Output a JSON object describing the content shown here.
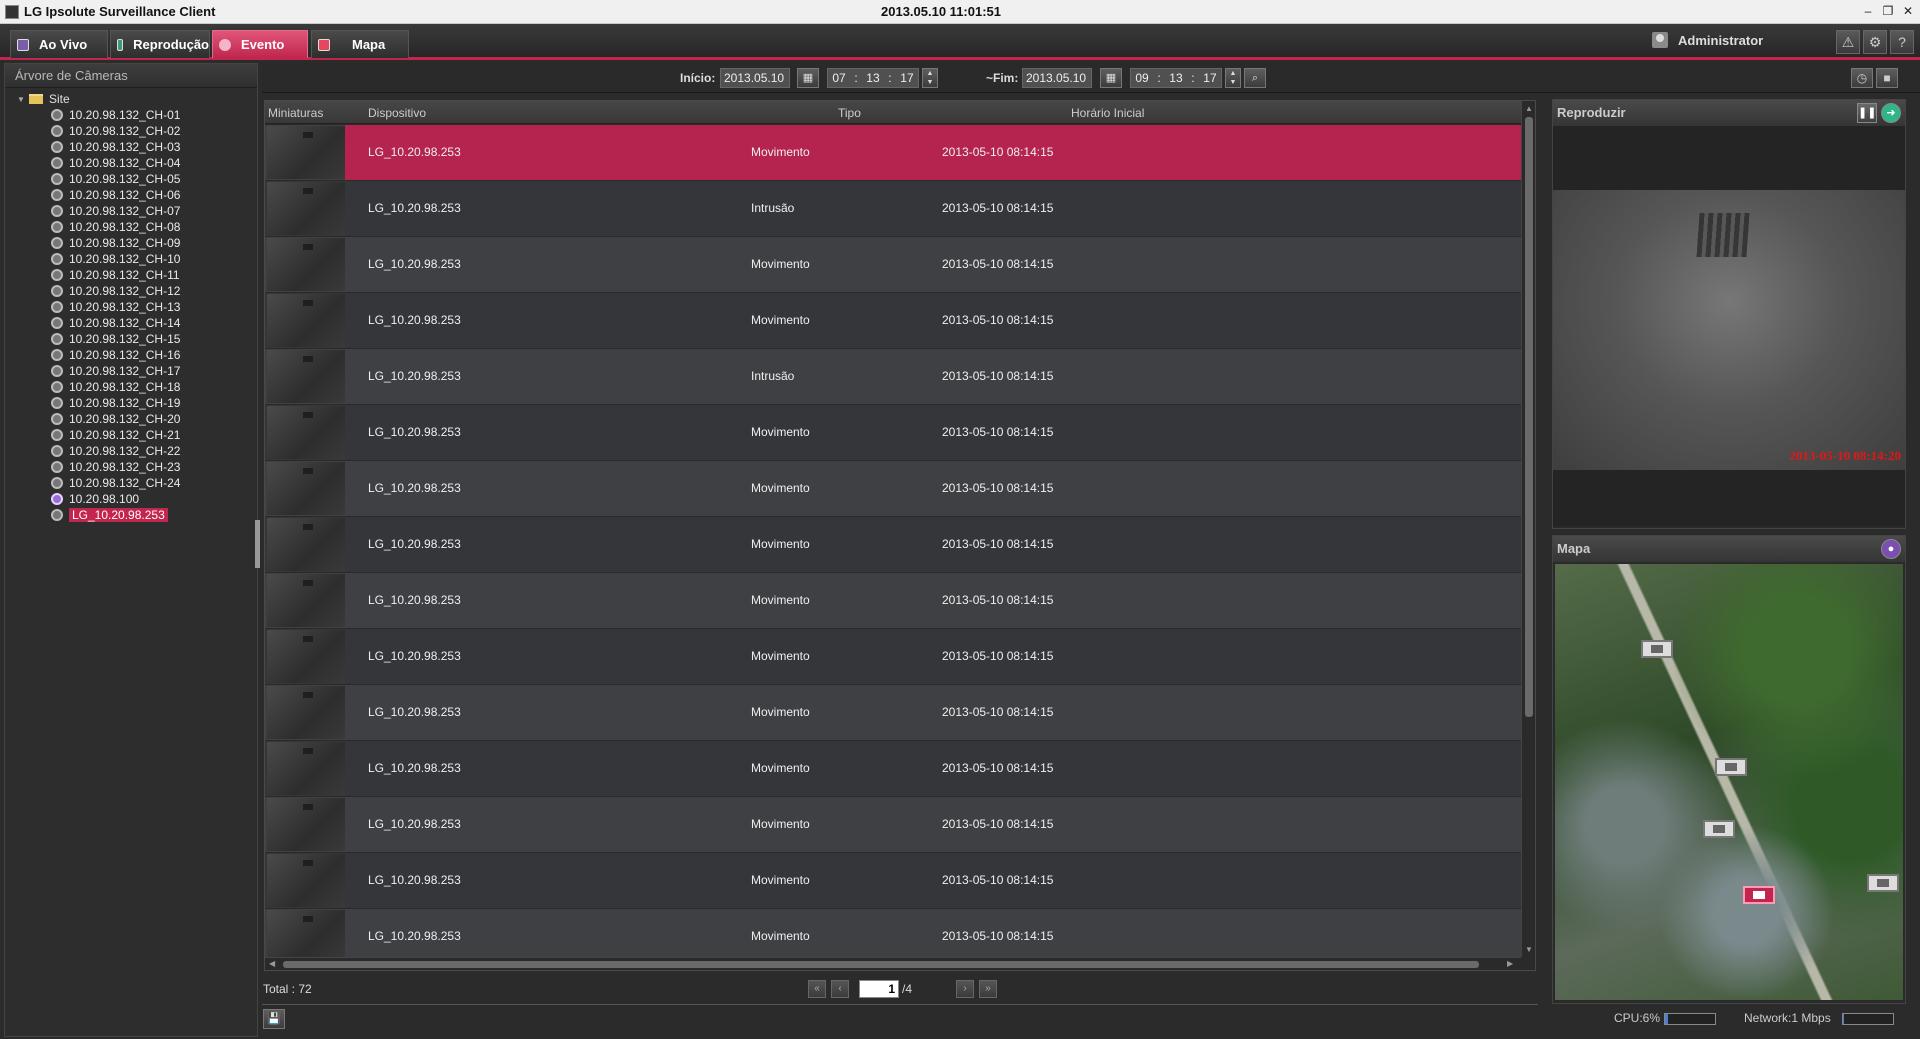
{
  "window": {
    "title": "LG Ipsolute Surveillance Client",
    "clock": "2013.05.10 11:01:51"
  },
  "nav": {
    "tabs": [
      {
        "label": "Ao Vivo",
        "active": false
      },
      {
        "label": "Reprodução",
        "active": false
      },
      {
        "label": "Evento",
        "active": true
      },
      {
        "label": "Mapa",
        "active": false
      }
    ],
    "user": "Administrator"
  },
  "camera_tree": {
    "title": "Árvore de Câmeras",
    "site": "Site",
    "items": [
      "10.20.98.132_CH-01",
      "10.20.98.132_CH-02",
      "10.20.98.132_CH-03",
      "10.20.98.132_CH-04",
      "10.20.98.132_CH-05",
      "10.20.98.132_CH-06",
      "10.20.98.132_CH-07",
      "10.20.98.132_CH-08",
      "10.20.98.132_CH-09",
      "10.20.98.132_CH-10",
      "10.20.98.132_CH-11",
      "10.20.98.132_CH-12",
      "10.20.98.132_CH-13",
      "10.20.98.132_CH-14",
      "10.20.98.132_CH-15",
      "10.20.98.132_CH-16",
      "10.20.98.132_CH-17",
      "10.20.98.132_CH-18",
      "10.20.98.132_CH-19",
      "10.20.98.132_CH-20",
      "10.20.98.132_CH-21",
      "10.20.98.132_CH-22",
      "10.20.98.132_CH-23",
      "10.20.98.132_CH-24",
      "10.20.98.100",
      "LG_10.20.98.253"
    ],
    "selected": "LG_10.20.98.253"
  },
  "filter": {
    "start_label": "Início:",
    "start_date": "2013.05.10",
    "start_time": {
      "h": "07",
      "m": "13",
      "s": "17"
    },
    "end_label": "~Fim:",
    "end_date": "2013.05.10",
    "end_time": {
      "h": "09",
      "m": "13",
      "s": "17"
    }
  },
  "table": {
    "columns": {
      "thumb": "Miniaturas",
      "device": "Dispositivo",
      "type": "Tipo",
      "time": "Horário Inicial"
    },
    "rows": [
      {
        "device": "LG_10.20.98.253",
        "type": "Movimento",
        "time": "2013-05-10 08:14:15"
      },
      {
        "device": "LG_10.20.98.253",
        "type": "Intrusão",
        "time": "2013-05-10 08:14:15"
      },
      {
        "device": "LG_10.20.98.253",
        "type": "Movimento",
        "time": "2013-05-10 08:14:15"
      },
      {
        "device": "LG_10.20.98.253",
        "type": "Movimento",
        "time": "2013-05-10 08:14:15"
      },
      {
        "device": "LG_10.20.98.253",
        "type": "Intrusão",
        "time": "2013-05-10 08:14:15"
      },
      {
        "device": "LG_10.20.98.253",
        "type": "Movimento",
        "time": "2013-05-10 08:14:15"
      },
      {
        "device": "LG_10.20.98.253",
        "type": "Movimento",
        "time": "2013-05-10 08:14:15"
      },
      {
        "device": "LG_10.20.98.253",
        "type": "Movimento",
        "time": "2013-05-10 08:14:15"
      },
      {
        "device": "LG_10.20.98.253",
        "type": "Movimento",
        "time": "2013-05-10 08:14:15"
      },
      {
        "device": "LG_10.20.98.253",
        "type": "Movimento",
        "time": "2013-05-10 08:14:15"
      },
      {
        "device": "LG_10.20.98.253",
        "type": "Movimento",
        "time": "2013-05-10 08:14:15"
      },
      {
        "device": "LG_10.20.98.253",
        "type": "Movimento",
        "time": "2013-05-10 08:14:15"
      },
      {
        "device": "LG_10.20.98.253",
        "type": "Movimento",
        "time": "2013-05-10 08:14:15"
      },
      {
        "device": "LG_10.20.98.253",
        "type": "Movimento",
        "time": "2013-05-10 08:14:15"
      },
      {
        "device": "LG_10.20.98.253",
        "type": "Movimento",
        "time": "2013-05-10 08:14:15"
      }
    ],
    "selected_index": 0
  },
  "pager": {
    "total": "Total : 72",
    "page": "1",
    "pages": "/4"
  },
  "playback": {
    "title": "Reproduzir",
    "timestamp": "2013-05-10 08:14:20"
  },
  "map": {
    "title": "Mapa"
  },
  "status": {
    "cpu": "CPU:6%",
    "cpu_fraction": 0.06,
    "network": "Network:1 Mbps",
    "network_fraction": 0.02
  },
  "colors": {
    "accent": "#c2264f",
    "row_selected": "#b5234f",
    "timestamp_overlay": "#e01818"
  }
}
